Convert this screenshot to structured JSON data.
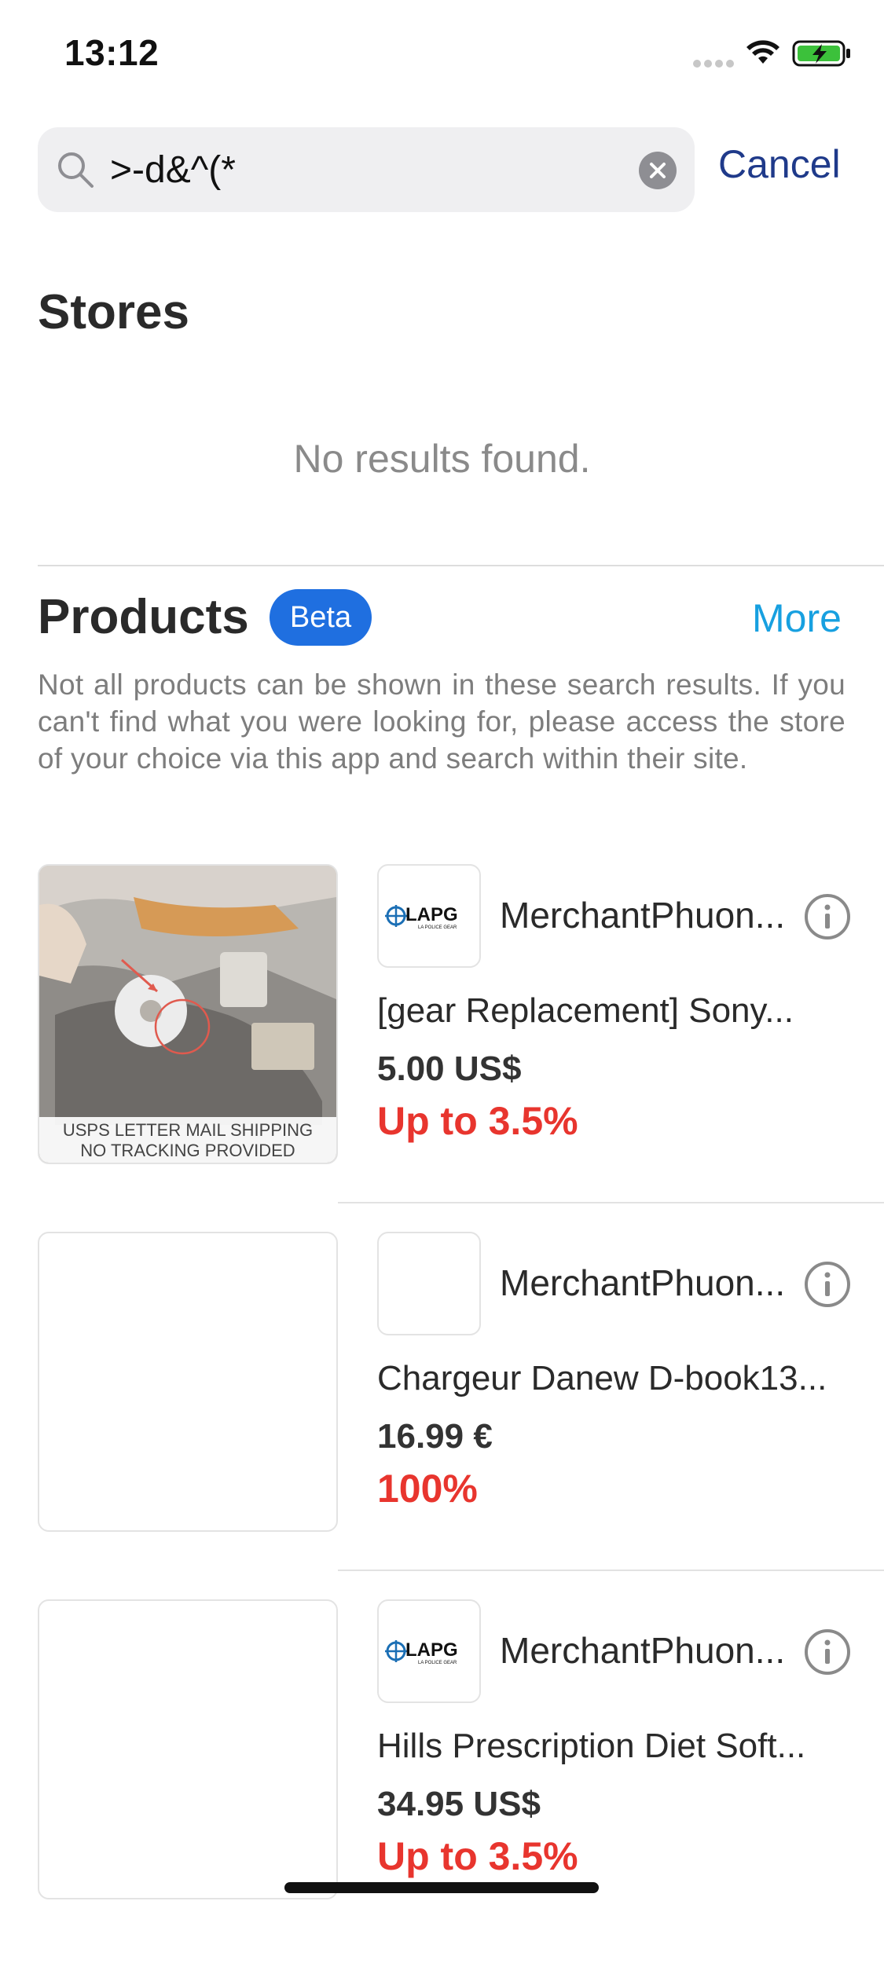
{
  "status_bar": {
    "time": "13:12"
  },
  "search": {
    "query": ">-d&^(*",
    "cancel_label": "Cancel"
  },
  "stores": {
    "title": "Stores",
    "empty_message": "No results found."
  },
  "products": {
    "title": "Products",
    "badge": "Beta",
    "more_label": "More",
    "disclaimer": "Not all products can be shown in these search results. If you can't find what you were looking for, please access the store of your choice via this app and search within their site.",
    "items": [
      {
        "merchant": "MerchantPhuon...",
        "logo_text": "LAPG",
        "logo_subtext": "LA POLICE GEAR",
        "title": "[gear Replacement] Sony...",
        "price": "5.00 US$",
        "cashback": "Up to 3.5%",
        "image_caption_line1": "USPS LETTER MAIL SHIPPING",
        "image_caption_line2": "NO TRACKING PROVIDED"
      },
      {
        "merchant": "MerchantPhuon...",
        "title": "Chargeur Danew D-book13...",
        "price": "16.99 €",
        "cashback": "100%"
      },
      {
        "merchant": "MerchantPhuon...",
        "logo_text": "LAPG",
        "logo_subtext": "LA POLICE GEAR",
        "title": "Hills Prescription Diet Soft...",
        "price": "34.95 US$",
        "cashback": "Up to 3.5%"
      }
    ]
  },
  "colors": {
    "accent_blue": "#1f3a8a",
    "link_blue": "#17a0e0",
    "badge_blue": "#1f6fe0",
    "cashback_red": "#e8352e",
    "battery_green": "#3cc13b"
  }
}
